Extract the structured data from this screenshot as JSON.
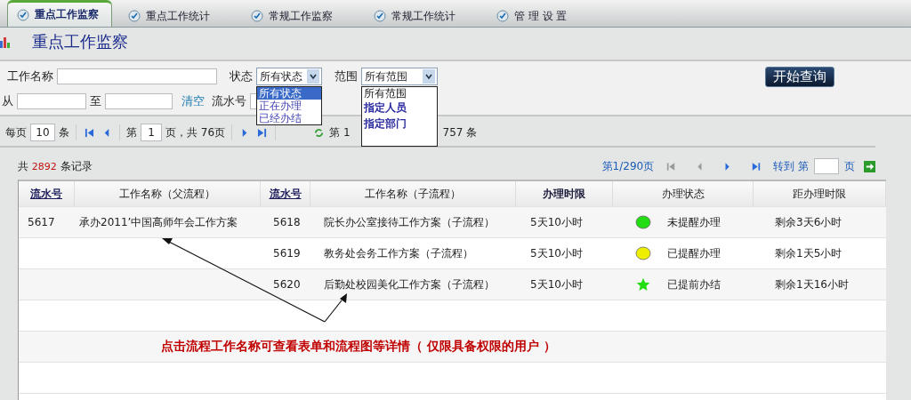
{
  "tabs": [
    {
      "label": "重点工作监察",
      "selected": true
    },
    {
      "label": "重点工作统计",
      "selected": false
    },
    {
      "label": "常规工作监察",
      "selected": false
    },
    {
      "label": "常规工作统计",
      "selected": false
    },
    {
      "label": "管 理 设 置",
      "selected": false
    }
  ],
  "page_title": "重点工作监察",
  "filters": {
    "name_label": "工作名称",
    "status": {
      "label": "状态",
      "value": "所有状态",
      "options": [
        {
          "label": "所有状态",
          "selected": true
        },
        {
          "label": "正在办理",
          "selected": false
        },
        {
          "label": "已经办结",
          "selected": false
        }
      ]
    },
    "scope": {
      "label": "范围",
      "value": "所有范围",
      "options": [
        {
          "label": "所有范围",
          "selected": true
        },
        {
          "label": "指定人员",
          "selected": false
        },
        {
          "label": "指定部门",
          "selected": false
        }
      ]
    },
    "from_label": "从",
    "to_label": "至",
    "clear_link": "清空",
    "serial_label": "流水号",
    "search_button": "开始查询"
  },
  "pager": {
    "per_page_label": "每页",
    "per_page": "10",
    "per_page_unit": "条",
    "page_prefix": "第",
    "page": "1",
    "page_suffix": "页，共 76页",
    "record_prefix": "第 1",
    "record_suffix": "757 条"
  },
  "summary": {
    "prefix": "共",
    "count": "2892",
    "suffix": "条记录"
  },
  "nav": {
    "page_info": "第1/290页",
    "goto_label": "转到 第",
    "goto_suffix": "页"
  },
  "table": {
    "columns": [
      {
        "label": "流水号",
        "kind": "link"
      },
      {
        "label": "工作名称（父流程）",
        "kind": "plain"
      },
      {
        "label": "流水号",
        "kind": "link"
      },
      {
        "label": "工作名称（子流程）",
        "kind": "plain"
      },
      {
        "label": "办理时限",
        "kind": "bold"
      },
      {
        "label": "办理状态",
        "kind": "plain"
      },
      {
        "label": "距办理时限",
        "kind": "plain"
      }
    ],
    "rows": [
      {
        "serial": "5617",
        "parent_name": "承办2011’中国高师年会工作方案",
        "child_serial": "5618",
        "child_name": "院长办公室接待工作方案（子流程）",
        "deadline": "5天10小时",
        "icon": {
          "kind": "dot",
          "color": "#22dd11"
        },
        "status": "未提醒办理",
        "remaining": "剩余3天6小时"
      },
      {
        "child_serial": "5619",
        "child_name": "教务处会务工作方案（子流程）",
        "deadline": "5天10小时",
        "icon": {
          "kind": "dot",
          "color": "#eeee00"
        },
        "status": "已提醒办理",
        "remaining": "剩余1天5小时"
      },
      {
        "child_serial": "5620",
        "child_name": "后勤处校园美化工作方案（子流程）",
        "deadline": "5天10小时",
        "icon": {
          "kind": "star",
          "color": "#22dd11"
        },
        "status": "已提前办结",
        "remaining": "剩余1天16小时"
      }
    ]
  },
  "annotation": "点击流程工作名称可查看表单和流程图等详情（ 仅限具备权限的用户 ）"
}
